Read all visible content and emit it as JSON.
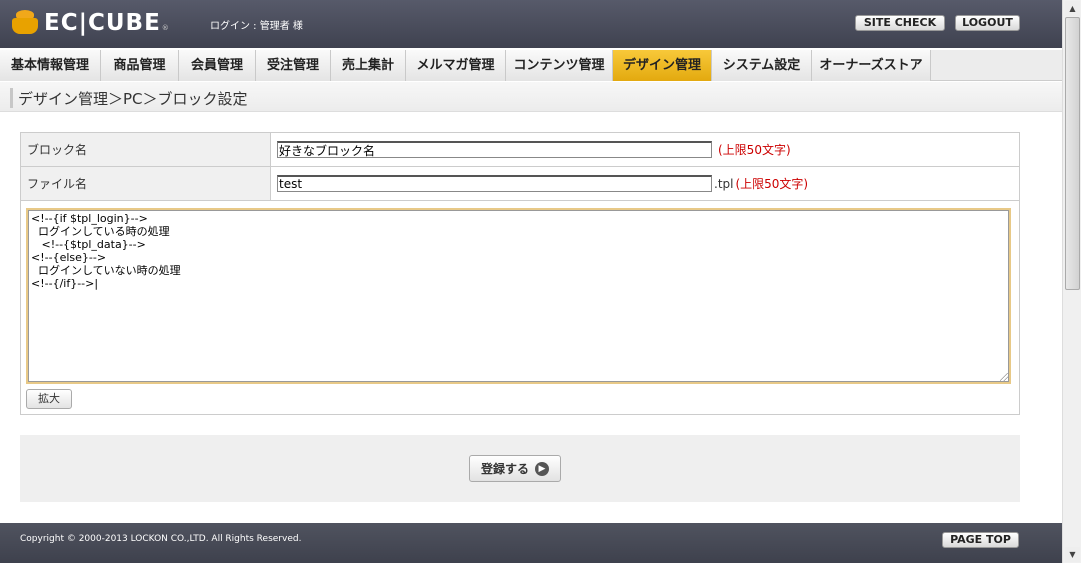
{
  "header": {
    "logo_text": "EC|CUBE",
    "logo_reg": "®",
    "login_info": "ログイン : 管理者 様",
    "site_check_label": "SITE CHECK",
    "logout_label": "LOGOUT"
  },
  "nav": {
    "items": [
      {
        "label": "基本情報管理"
      },
      {
        "label": "商品管理"
      },
      {
        "label": "会員管理"
      },
      {
        "label": "受注管理"
      },
      {
        "label": "売上集計"
      },
      {
        "label": "メルマガ管理"
      },
      {
        "label": "コンテンツ管理"
      },
      {
        "label": "デザイン管理"
      },
      {
        "label": "システム設定"
      },
      {
        "label": "オーナーズストア"
      }
    ],
    "active": "デザイン管理"
  },
  "page_title": "デザイン管理＞PC＞ブロック設定",
  "form": {
    "block_name_label": "ブロック名",
    "block_name_value": "好きなブロック名",
    "block_name_limit": "(上限50文字)",
    "file_name_label": "ファイル名",
    "file_name_value": "test",
    "file_name_ext": ".tpl",
    "file_name_limit": "(上限50文字)",
    "code": "<!--{if $tpl_login}-->\n  ログインしている時の処理\n   <!--{$tpl_data}-->\n<!--{else}-->\n  ログインしていない時の処理\n<!--{/if}-->|",
    "expand_label": "拡大",
    "submit_label": "登録する"
  },
  "footer": {
    "copyright": "Copyright © 2000-2013 LOCKON CO.,LTD. All Rights Reserved.",
    "page_top_label": "PAGE TOP"
  },
  "colors": {
    "header_bg": "#4a4d5b",
    "active_tab": "#f0b820",
    "limit_text": "#cc0000"
  }
}
